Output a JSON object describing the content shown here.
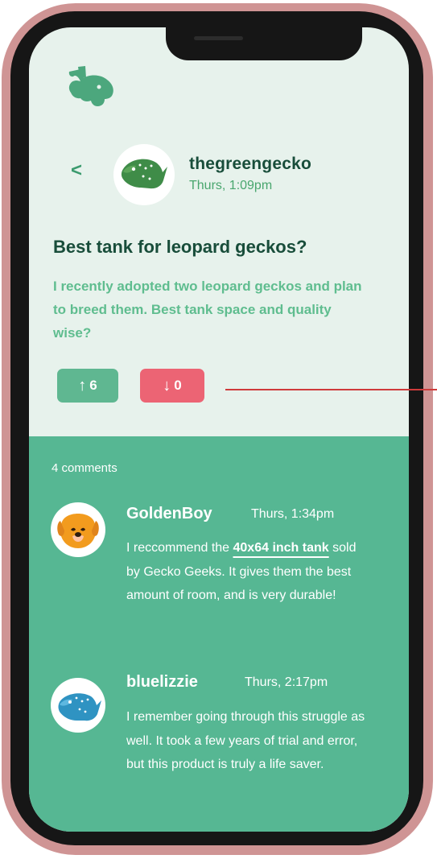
{
  "app": {
    "logo_icon": "rabbit-icon"
  },
  "header": {
    "back": "<",
    "username": "thegreengecko",
    "timestamp": "Thurs, 1:09pm"
  },
  "post": {
    "title": "Best tank for leopard geckos?",
    "body": "I recently adopted two leopard geckos and plan to breed them. Best tank space and quality wise?",
    "upvotes": "6",
    "downvotes": "0"
  },
  "comments": {
    "count_label": "4 comments",
    "items": [
      {
        "author": "GoldenBoy",
        "timestamp": "Thurs, 1:34pm",
        "body_before": "I reccommend the ",
        "link_text": "40x64 inch tank",
        "body_after": " sold by Gecko Geeks. It gives them the best amount of room, and is very durable!"
      },
      {
        "author": "bluelizzie",
        "timestamp": "Thurs, 2:17pm",
        "body": "I remember going through this struggle as well. It took a few years of trial and error, but this product is truly a life saver."
      }
    ]
  },
  "colors": {
    "screen_background": "#e7f2ec",
    "comments_background": "#56b793",
    "title_text": "#184d3a",
    "body_text": "#5fbd8f",
    "upvote": "#5fb791",
    "downvote": "#ec6474",
    "frame": "#cf9494"
  }
}
